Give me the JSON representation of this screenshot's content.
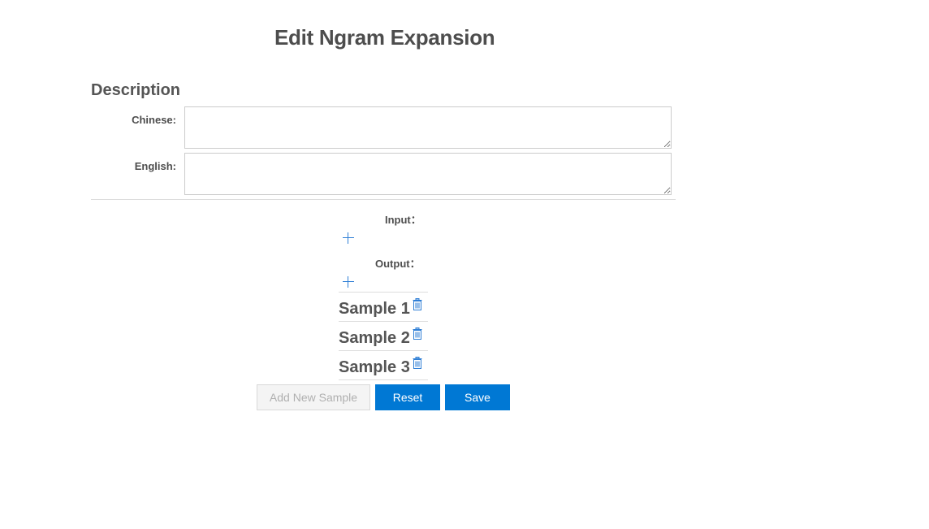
{
  "page": {
    "title": "Edit Ngram Expansion"
  },
  "description": {
    "heading": "Description",
    "chinese": {
      "label": "Chinese:",
      "value": ""
    },
    "english": {
      "label": "English:",
      "value": ""
    }
  },
  "io": {
    "input_label": "Input：",
    "output_label": "Output："
  },
  "icons": {
    "add": "plus-icon",
    "delete": "trash-icon"
  },
  "samples": [
    {
      "label": "Sample 1"
    },
    {
      "label": "Sample 2"
    },
    {
      "label": "Sample 3"
    }
  ],
  "actions": {
    "add_sample_label": "Add New Sample",
    "add_sample_disabled": true,
    "reset_label": "Reset",
    "save_label": "Save"
  },
  "colors": {
    "primary": "#0078d4",
    "icon_accent": "#2f7fd6",
    "text": "#4d4d4d"
  }
}
